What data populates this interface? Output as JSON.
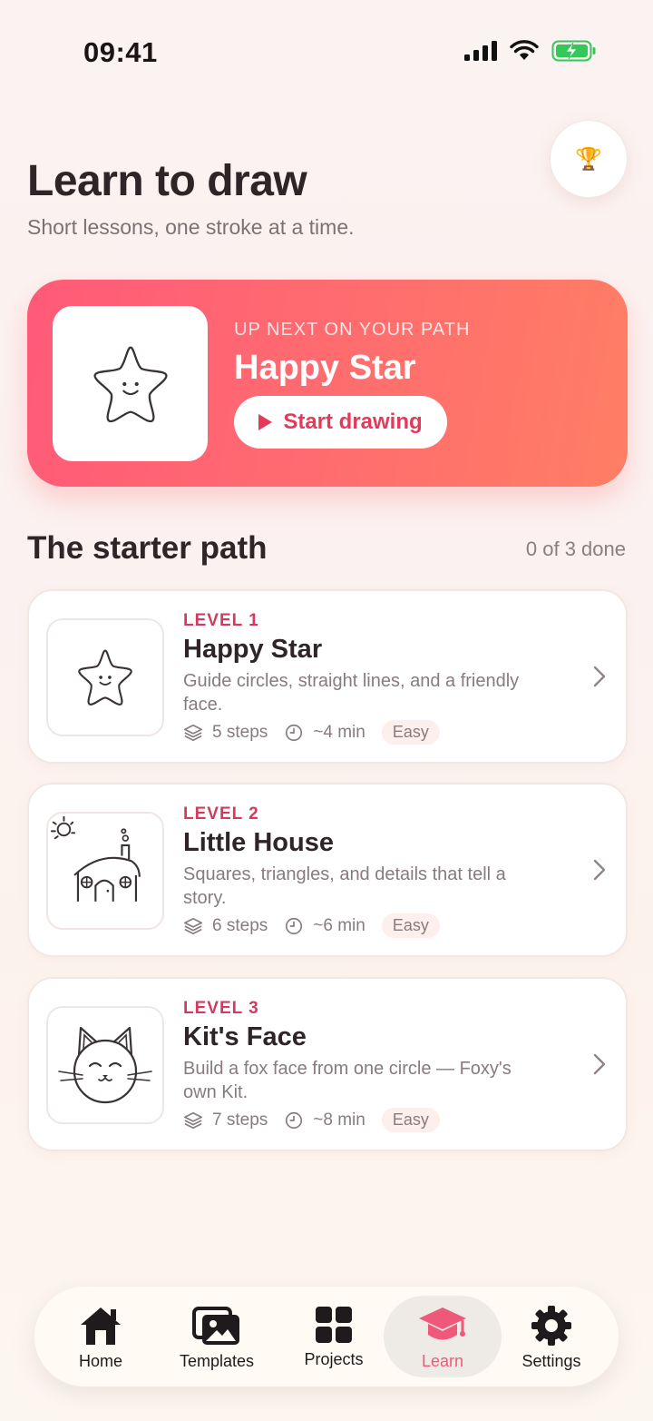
{
  "status": {
    "time": "09:41"
  },
  "header": {
    "title": "Learn to draw",
    "subtitle": "Short lessons, one stroke at a time.",
    "trophy_icon": "trophy-icon"
  },
  "hero": {
    "eyebrow": "UP NEXT ON YOUR PATH",
    "title": "Happy Star",
    "cta": "Start drawing",
    "gradient": [
      "#ff5a78",
      "#ff7e64"
    ]
  },
  "section": {
    "title": "The starter path",
    "count": "0 of 3 done"
  },
  "lessons": [
    {
      "level": "LEVEL 1",
      "title": "Happy Star",
      "desc": "Guide circles, straight lines, and a friendly face.",
      "steps": "5 steps",
      "time": "~4 min",
      "difficulty": "Easy",
      "icon": "star-drawing-icon"
    },
    {
      "level": "LEVEL 2",
      "title": "Little House",
      "desc": "Squares, triangles, and details that tell a story.",
      "steps": "6 steps",
      "time": "~6 min",
      "difficulty": "Easy",
      "icon": "house-drawing-icon"
    },
    {
      "level": "LEVEL 3",
      "title": "Kit's Face",
      "desc": "Build a fox face from one circle — Foxy's own Kit.",
      "steps": "7 steps",
      "time": "~8 min",
      "difficulty": "Easy",
      "icon": "cat-drawing-icon"
    }
  ],
  "tabs": [
    {
      "label": "Home",
      "icon": "home-icon"
    },
    {
      "label": "Templates",
      "icon": "images-icon"
    },
    {
      "label": "Projects",
      "icon": "grid-icon"
    },
    {
      "label": "Learn",
      "icon": "graduation-cap-icon",
      "active": true
    },
    {
      "label": "Settings",
      "icon": "gear-icon"
    }
  ],
  "colors": {
    "accent": "#e5395a",
    "active_tab": "#f0587a",
    "battery": "#34c759"
  }
}
